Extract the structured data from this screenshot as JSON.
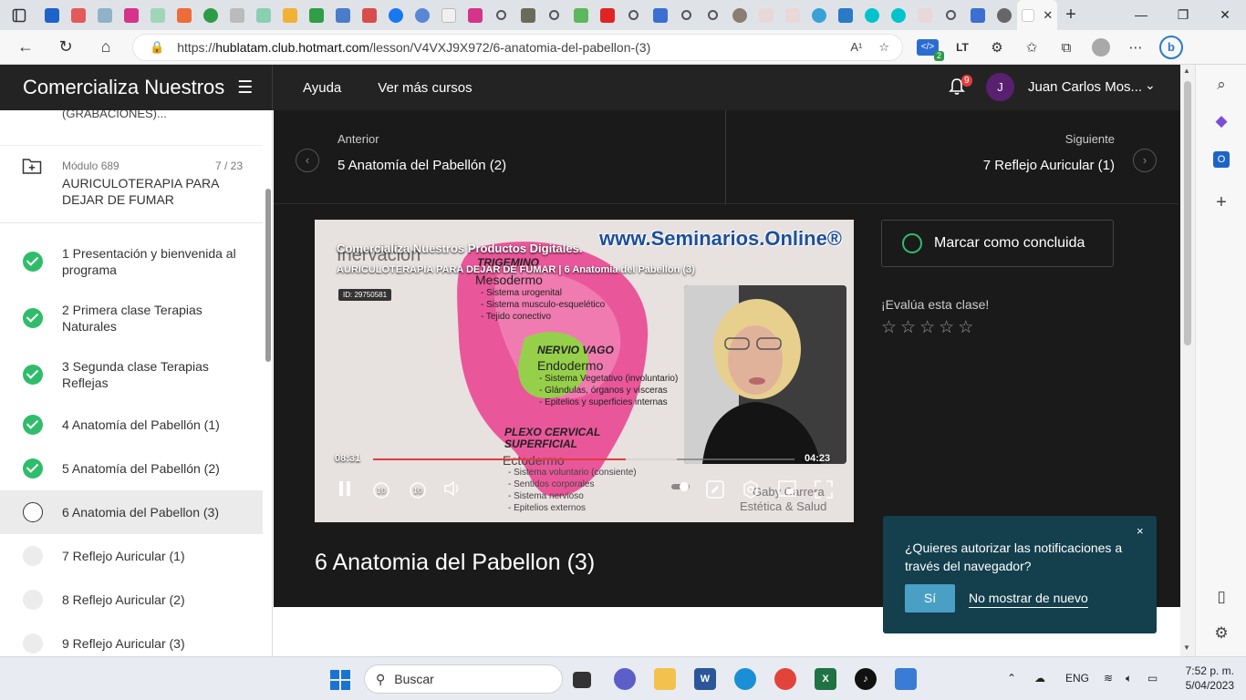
{
  "browser": {
    "url_prefix": "https://",
    "url_domain": "hublatam.club.hotmart.com",
    "url_path": "/lesson/V4VXJ9X972/6-anatomia-del-pabellon-(3)",
    "read_aloud": "A¹",
    "extension_badge": "2"
  },
  "header": {
    "brand": "Comercializa Nuestros",
    "nav": [
      "Ayuda",
      "Ver más cursos"
    ],
    "notif_count": "9",
    "avatar_initial": "J",
    "user_name": "Juan Carlos Mos..."
  },
  "sidebar": {
    "cut_text": "(GRABACIONES)...",
    "module_label": "Módulo 689",
    "module_count": "7 / 23",
    "module_title": "AURICULOTERAPIA PARA DEJAR DE FUMAR",
    "lessons": [
      {
        "label": "1 Presentación y bienvenida al programa",
        "status": "done"
      },
      {
        "label": "2 Primera clase Terapias Naturales",
        "status": "done"
      },
      {
        "label": "3 Segunda clase Terapias Reflejas",
        "status": "done"
      },
      {
        "label": "4 Anatomía del Pabellón (1)",
        "status": "done"
      },
      {
        "label": "5 Anatomía del Pabellón (2)",
        "status": "done"
      },
      {
        "label": "6 Anatomia del Pabellon (3)",
        "status": "current"
      },
      {
        "label": "7 Reflejo Auricular (1)",
        "status": "todo"
      },
      {
        "label": "8 Reflejo Auricular (2)",
        "status": "todo"
      },
      {
        "label": "9 Reflejo Auricular (3)",
        "status": "todo"
      }
    ]
  },
  "navigation": {
    "prev_label": "Anterior",
    "prev_title": "5 Anatomía del Pabellón (2)",
    "next_label": "Siguiente",
    "next_title": "7 Reflejo Auricular (1)"
  },
  "video": {
    "title": "Comercializa Nuestros Productos Digitales.",
    "subtitle": "AURICULOTERAPIA PARA DEJAR DE FUMAR | 6 Anatomia del Pabellon (3)",
    "id": "ID: 29750581",
    "watermark": "www.Seminarios.Online®",
    "current_time": "08:31",
    "duration": "04:23",
    "progress": 0.6,
    "buffered": 0.72,
    "slide": {
      "heading": "Inervación",
      "n1": "TRIGEMINO",
      "n1_sub": "Mesodermo",
      "n1_items": [
        "- Sistema urogenital",
        "- Sistema musculo-esquelético",
        "- Tejido conectivo"
      ],
      "n2": "NERVIO VAGO",
      "n2_sub": "Endodermo",
      "n2_items": [
        "- Sistema Vegetativo (involuntario)",
        "- Glándulas, órganos y vísceras",
        "- Epitelios y superficies internas"
      ],
      "n3a": "PLEXO CERVICAL",
      "n3b": "SUPERFICIAL",
      "n3_sub": "Ectodermo",
      "n3_items": [
        "- Sistema voluntario (consiente)",
        "- Sentidos corporales",
        "- Sistema nervioso",
        "- Epitelios externos"
      ],
      "brand1": "Gaby Carrera",
      "brand2": "Estética & Salud"
    },
    "colors": {
      "ear": "#e9579a",
      "green_zone": "#96d04a",
      "progress": "#e23d3d"
    }
  },
  "lesson": {
    "mark_done": "Marcar como concluida",
    "rate_label": "¡Evalúa esta clase!",
    "stars": [
      "☆",
      "☆",
      "☆",
      "☆",
      "☆"
    ],
    "title": "6 Anatomia del Pabellon (3)"
  },
  "notification": {
    "text": "¿Quieres autorizar las notificaciones a través del navegador?",
    "yes": "Sí",
    "no": "No mostrar de nuevo",
    "close": "×"
  },
  "taskbar": {
    "search": "Buscar",
    "lang": "ENG",
    "time": "7:52 p. m.",
    "date": "5/04/2023"
  },
  "accent_colors": {
    "done_green": "#2fbd6b",
    "header_dark": "#232323",
    "content_dark": "#1a1a1a",
    "notif_bg": "#143f4d",
    "notif_button": "#4a9fc4"
  }
}
